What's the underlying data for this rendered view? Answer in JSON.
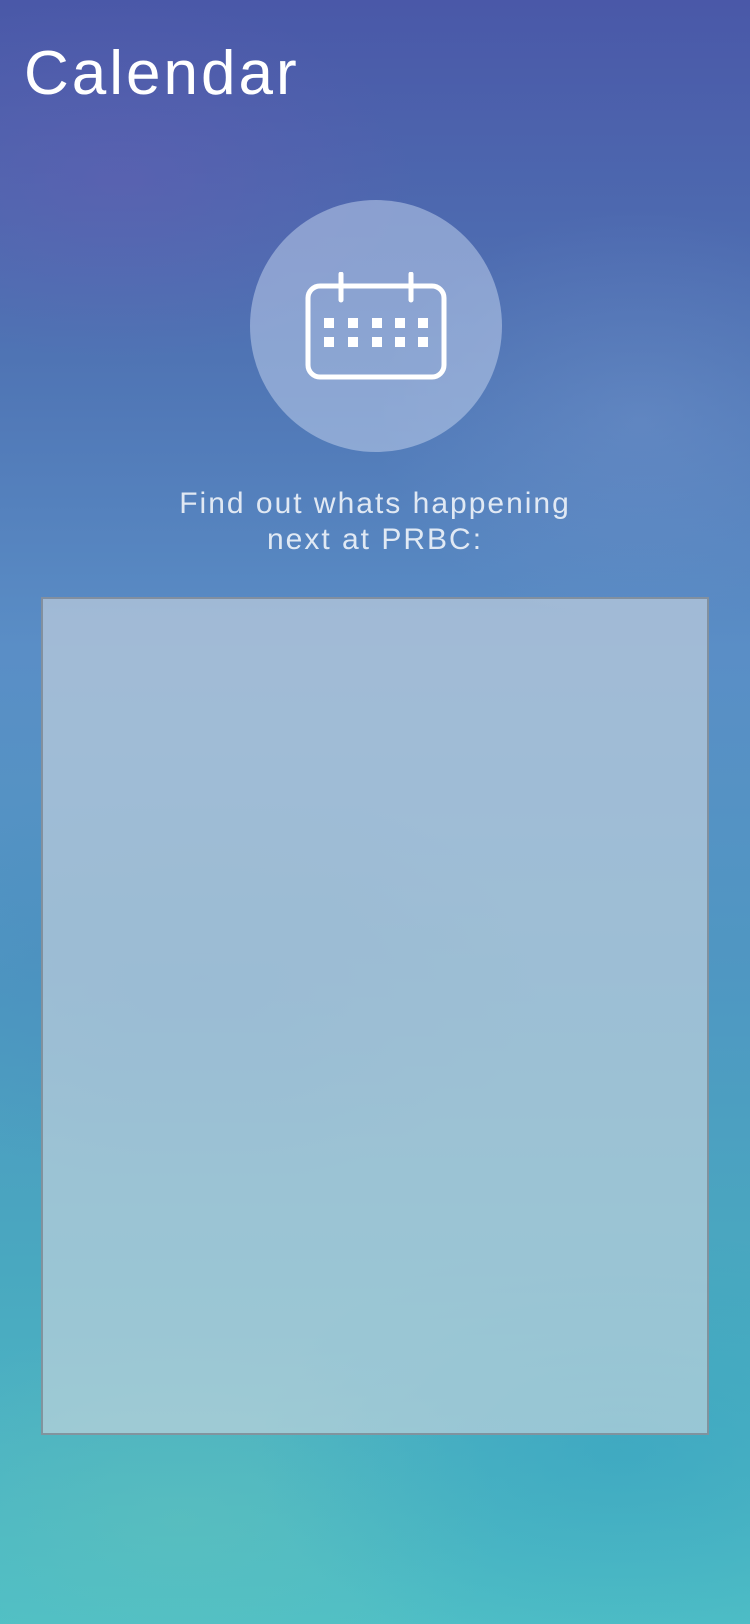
{
  "header": {
    "title": "Calendar"
  },
  "hero": {
    "icon": "calendar-icon",
    "subtitle_line1": "Find out whats happening",
    "subtitle_line2": "next at PRBC:"
  },
  "calendar_panel": {
    "content": ""
  },
  "colors": {
    "background_top": "#4a58a8",
    "background_bottom": "#4fbfc6",
    "text": "#ffffff"
  }
}
